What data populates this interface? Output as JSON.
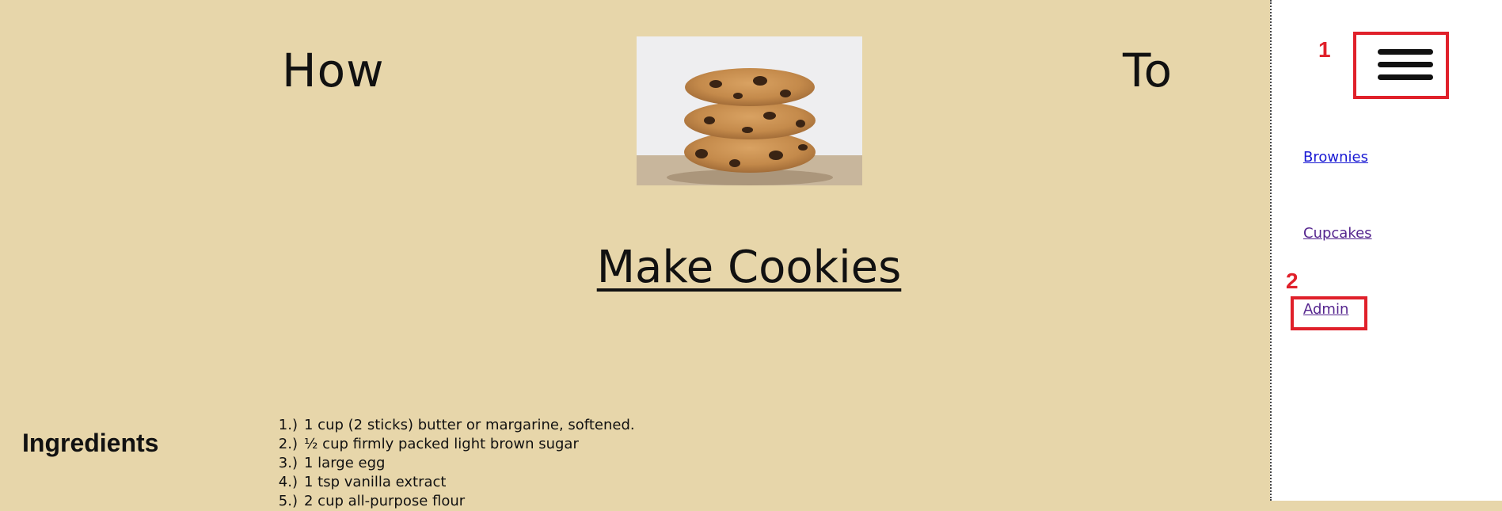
{
  "page": {
    "background_color": "#e7d6aa",
    "sidebar_background": "#ffffff",
    "annotation_color": "#e0202a"
  },
  "header": {
    "word_left": "How",
    "word_right": "To",
    "title": "Make Cookies",
    "image_subject": "stack of chocolate chip cookies"
  },
  "ingredients": {
    "heading": "Ingredients",
    "items": [
      {
        "num": "1.)",
        "text": "1 cup (2 sticks) butter or margarine, softened."
      },
      {
        "num": "2.)",
        "text": "½ cup firmly packed light brown sugar"
      },
      {
        "num": "3.)",
        "text": "1 large egg"
      },
      {
        "num": "4.)",
        "text": "1 tsp vanilla extract"
      },
      {
        "num": "5.)",
        "text": "2 cup all-purpose flour"
      }
    ]
  },
  "sidebar": {
    "menu_icon": "hamburger-menu-icon",
    "links": [
      {
        "label": "Brownies",
        "color": "#1a1ad4"
      },
      {
        "label": "Cupcakes",
        "color": "#55258e"
      },
      {
        "label": "Admin",
        "color": "#55258e"
      }
    ]
  },
  "annotations": {
    "marker_1": "1",
    "marker_2": "2"
  }
}
